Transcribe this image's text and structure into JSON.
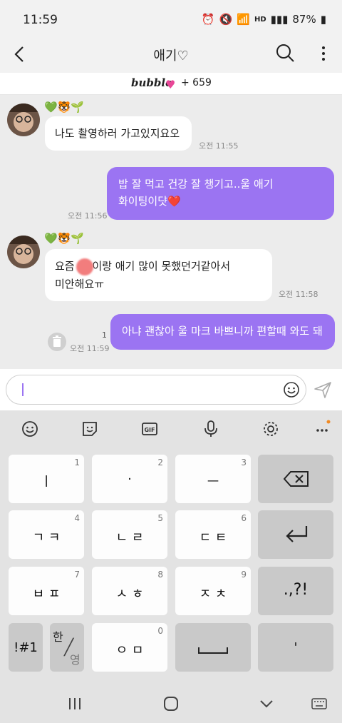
{
  "status_bar": {
    "time": "11:59",
    "hd_label": "HD",
    "battery": "87%"
  },
  "header": {
    "title": "애기♡",
    "bubble_logo": "bubble",
    "bubble_heart": "♥",
    "bubble_count": "+ 659"
  },
  "messages": [
    {
      "side": "in",
      "emojis": "💚🐯🌱",
      "text": "나도 촬영하러 가고있지요오",
      "time": "오전 11:55"
    },
    {
      "side": "out",
      "text_line1": "밥 잘 먹고 건강 잘 챙기고..울 애기",
      "text_line2": "화이팅이댯❤️",
      "time": "오전 11:56"
    },
    {
      "side": "in",
      "emojis": "💚🐯🌱",
      "text_pre": "요즘 ",
      "text_post": "이랑 애기 많이 못했던거같아서",
      "text_line2": "미안해요ㅠ",
      "time": "오전 11:58"
    },
    {
      "side": "out",
      "text": "아냐 괜찮아 울 마크 바쁘니까 편할때 와도 돼",
      "unread": "1",
      "time": "오전 11:59"
    }
  ],
  "input": {
    "placeholder": ""
  },
  "keyboard": {
    "rows": [
      [
        {
          "num": "1",
          "label": "ㅣ"
        },
        {
          "num": "2",
          "label": "·"
        },
        {
          "num": "3",
          "label": "ㅡ"
        },
        {
          "num": "",
          "label": "backspace"
        }
      ],
      [
        {
          "num": "4",
          "label": "ㄱ ㅋ"
        },
        {
          "num": "5",
          "label": "ㄴ ㄹ"
        },
        {
          "num": "6",
          "label": "ㄷ ㅌ"
        },
        {
          "num": "",
          "label": "enter"
        }
      ],
      [
        {
          "num": "7",
          "label": "ㅂ ㅍ"
        },
        {
          "num": "8",
          "label": "ㅅ ㅎ"
        },
        {
          "num": "9",
          "label": "ㅈ ㅊ"
        },
        {
          "num": "",
          "label": ".,?!"
        }
      ],
      [
        {
          "num": "",
          "label": "!#1"
        },
        {
          "num": "",
          "label_top": "한",
          "label_bottom": "영"
        },
        {
          "num": "0",
          "label": "ㅇ ㅁ"
        },
        {
          "num": "",
          "label": "space"
        },
        {
          "num": "",
          "label": "'"
        }
      ]
    ]
  }
}
